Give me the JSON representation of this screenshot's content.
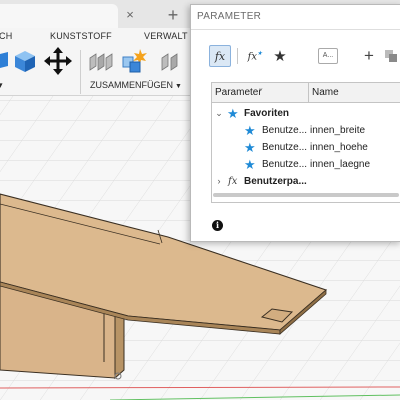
{
  "ribbon": {
    "tabs": [
      "CH",
      "KUNSTSTOFF",
      "VERWALT"
    ],
    "groups": [
      "ZUSAMMENFÜGEN"
    ]
  },
  "tabstrip": {
    "close_glyph": "×",
    "new_glyph": "+"
  },
  "dialog": {
    "title": "PARAMETER",
    "toolbar": {
      "fx": "fx",
      "fx_fav": "fx",
      "star": "★",
      "text_field": "A...",
      "add": "+"
    },
    "table": {
      "columns": [
        "Parameter",
        "Name"
      ],
      "sort_indicator": "⌄",
      "groups": [
        {
          "label": "Favoriten",
          "expanded": true,
          "icon": "star-icon",
          "rows": [
            {
              "parameter": "Benutze...",
              "name": "innen_breite"
            },
            {
              "parameter": "Benutze...",
              "name": "innen_hoehe"
            },
            {
              "parameter": "Benutze...",
              "name": "innen_laegne"
            }
          ]
        },
        {
          "label": "Benutzerpa...",
          "expanded": false,
          "icon": "fx-icon"
        }
      ]
    },
    "info_glyph": "i"
  },
  "colors": {
    "accent_blue": "#1f8ad6",
    "model_wood": "#d8b588",
    "model_edge": "#3a2f22"
  }
}
